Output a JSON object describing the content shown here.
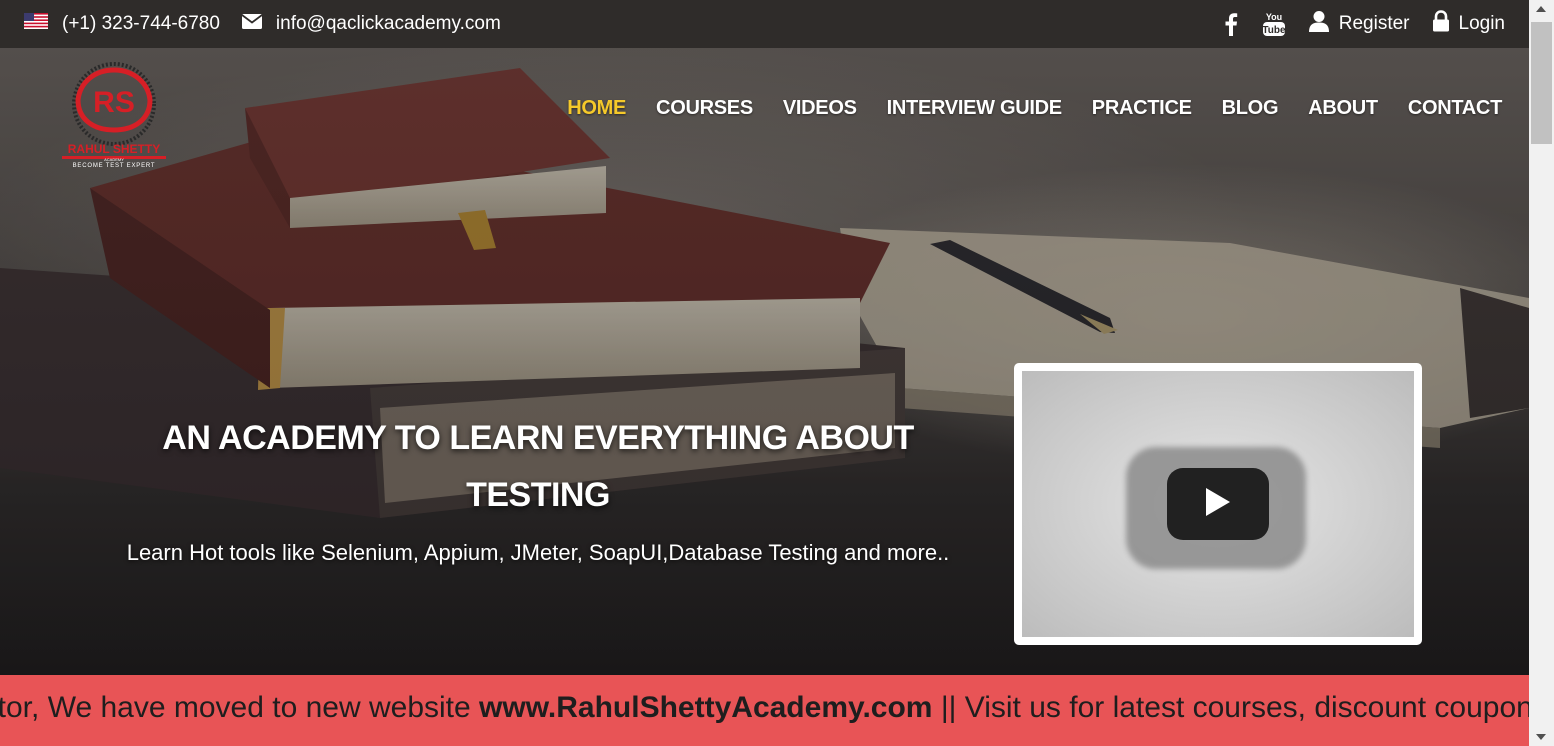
{
  "topbar": {
    "phone": "(+1) 323-744-6780",
    "email": "info@qaclickacademy.com",
    "register_label": "Register",
    "login_label": "Login",
    "icons": [
      "us-flag-icon",
      "envelope-icon",
      "facebook-icon",
      "youtube-icon",
      "user-icon",
      "lock-icon"
    ]
  },
  "logo": {
    "initials": "RS",
    "name": "RAHUL SHETTY",
    "sub": "ACADEMY",
    "tagline": "BECOME TEST EXPERT"
  },
  "nav": {
    "items": [
      {
        "label": "HOME",
        "active": true
      },
      {
        "label": "COURSES"
      },
      {
        "label": "VIDEOS"
      },
      {
        "label": "INTERVIEW GUIDE"
      },
      {
        "label": "PRACTICE"
      },
      {
        "label": "BLOG"
      },
      {
        "label": "ABOUT"
      },
      {
        "label": "CONTACT"
      }
    ],
    "active_color": "#f5c92a"
  },
  "hero": {
    "headline": "AN ACADEMY TO LEARN EVERYTHING ABOUT TESTING",
    "subline": "Learn Hot tools like Selenium, Appium, JMeter, SoapUI,Database Testing and more.."
  },
  "ticker": {
    "prefix": "sitor, We have moved to new website ",
    "site": "www.RahulShettyAcademy.com",
    "suffix": " || Visit us for latest courses, discount coupons",
    "background": "#e85456"
  },
  "colors": {
    "topbar_bg": "#2f2c2a",
    "brand_red": "#d61f26"
  }
}
